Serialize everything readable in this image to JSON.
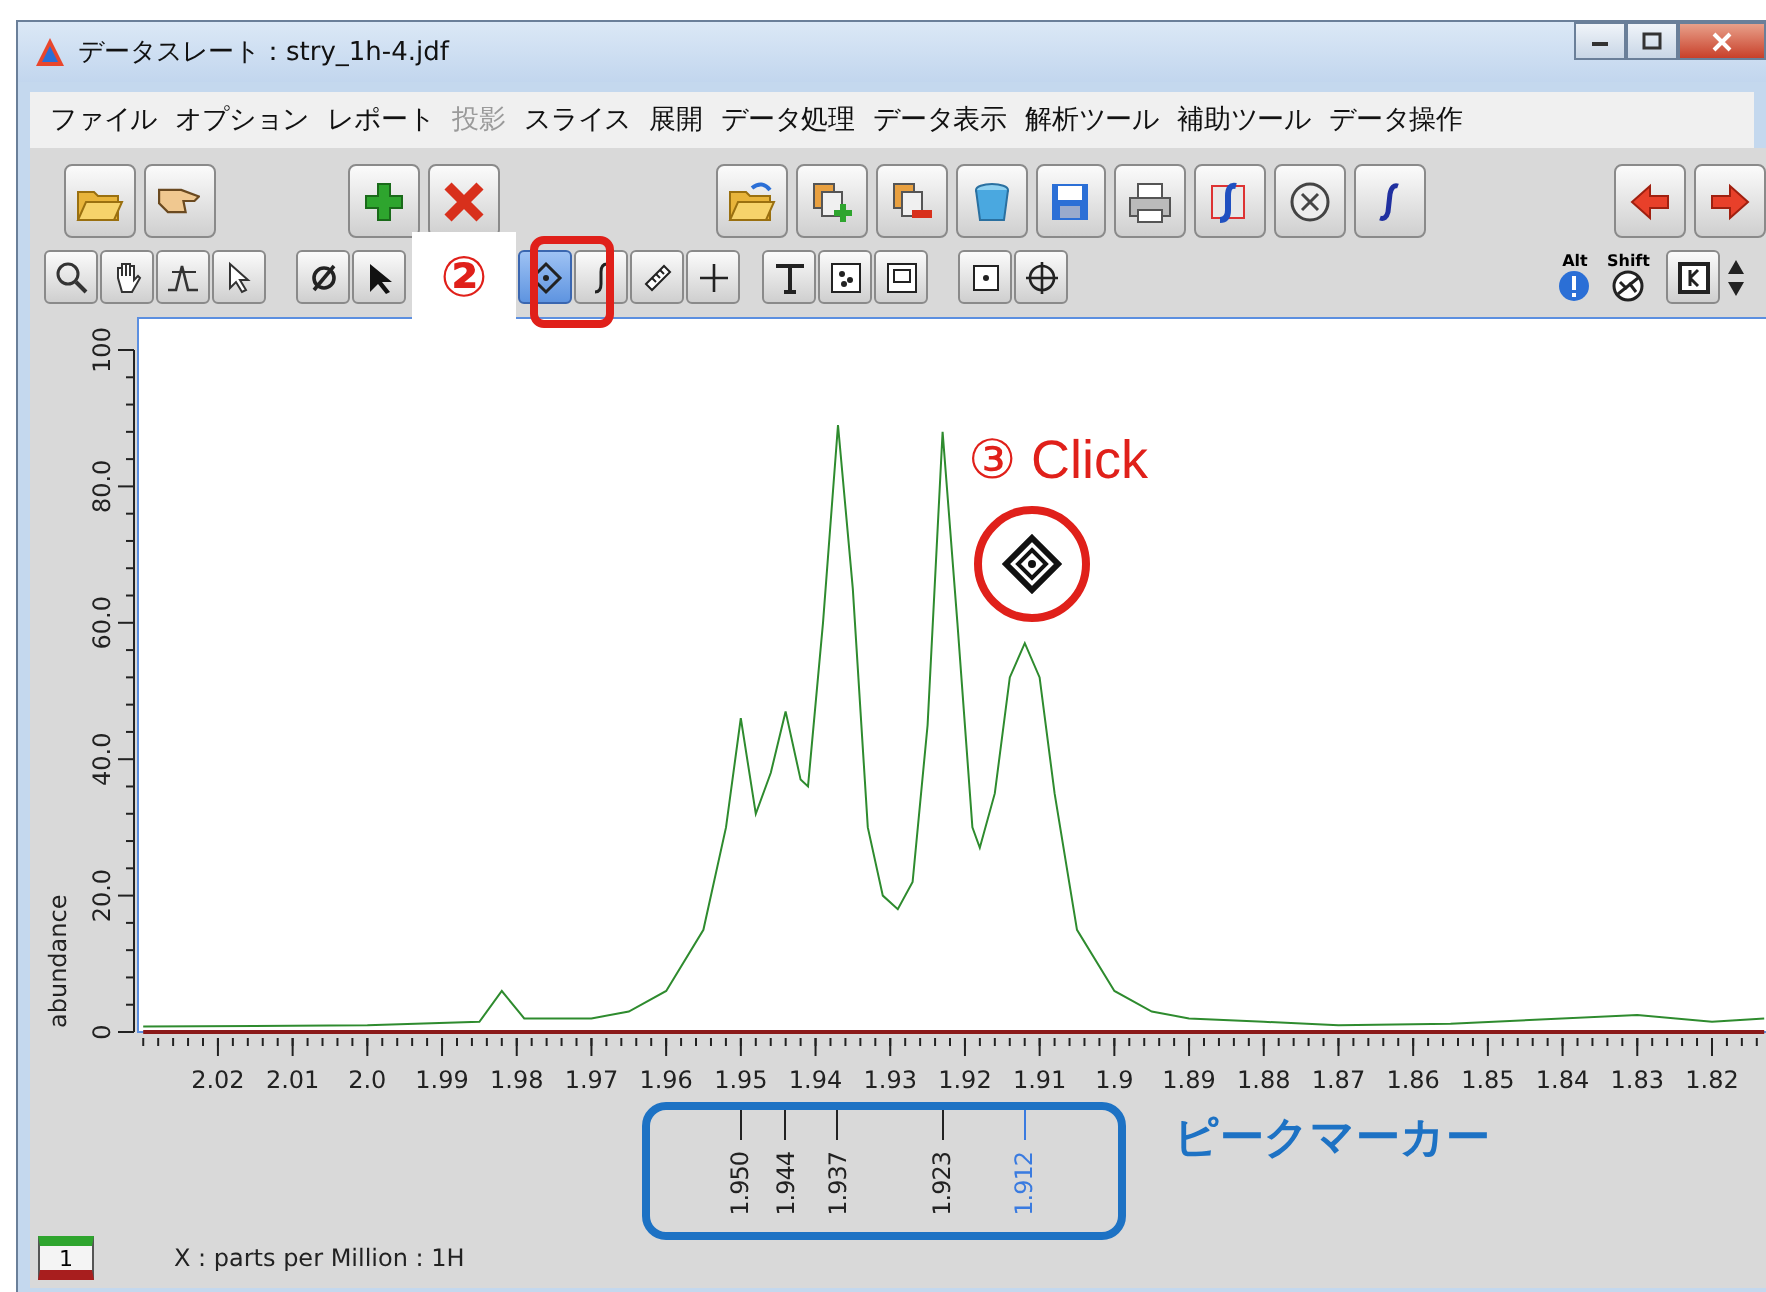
{
  "window": {
    "title": "データスレート：stry_1h-4.jdf"
  },
  "menu": [
    {
      "label": "ファイル",
      "disabled": false
    },
    {
      "label": "オプション",
      "disabled": false
    },
    {
      "label": "レポート",
      "disabled": false
    },
    {
      "label": "投影",
      "disabled": true
    },
    {
      "label": "スライス",
      "disabled": false
    },
    {
      "label": "展開",
      "disabled": false
    },
    {
      "label": "データ処理",
      "disabled": false
    },
    {
      "label": "データ表示",
      "disabled": false
    },
    {
      "label": "解析ツール",
      "disabled": false
    },
    {
      "label": "補助ツール",
      "disabled": false
    },
    {
      "label": "データ操作",
      "disabled": false
    }
  ],
  "toolbar2": [
    {
      "selected": false
    },
    {
      "selected": false
    },
    {
      "selected": false
    },
    {
      "selected": false
    },
    {
      "selected": false
    },
    {
      "selected": false
    },
    {
      "selected": true
    },
    {
      "selected": false
    },
    {
      "selected": false
    },
    {
      "selected": false
    },
    {
      "selected": false
    },
    {
      "selected": false
    },
    {
      "selected": false
    },
    {
      "selected": false
    },
    {
      "selected": false
    }
  ],
  "modifiers": [
    "Alt",
    "Shift"
  ],
  "plot": {
    "chart_data": {
      "type": "line",
      "ylabel": "abundance",
      "xlim": [
        2.0307,
        1.8125
      ],
      "ylim": [
        0,
        100
      ],
      "xticks": [
        {
          "value": 2.02,
          "label": "2.02"
        },
        {
          "value": 2.01,
          "label": "2.01"
        },
        {
          "value": 2.0,
          "label": "2.0"
        },
        {
          "value": 1.99,
          "label": "1.99"
        },
        {
          "value": 1.98,
          "label": "1.98"
        },
        {
          "value": 1.97,
          "label": "1.97"
        },
        {
          "value": 1.96,
          "label": "1.96"
        },
        {
          "value": 1.95,
          "label": "1.95"
        },
        {
          "value": 1.94,
          "label": "1.94"
        },
        {
          "value": 1.93,
          "label": "1.93"
        },
        {
          "value": 1.92,
          "label": "1.92"
        },
        {
          "value": 1.91,
          "label": "1.91"
        },
        {
          "value": 1.9,
          "label": "1.9"
        },
        {
          "value": 1.89,
          "label": "1.89"
        },
        {
          "value": 1.88,
          "label": "1.88"
        },
        {
          "value": 1.87,
          "label": "1.87"
        },
        {
          "value": 1.86,
          "label": "1.86"
        },
        {
          "value": 1.85,
          "label": "1.85"
        },
        {
          "value": 1.84,
          "label": "1.84"
        },
        {
          "value": 1.83,
          "label": "1.83"
        },
        {
          "value": 1.82,
          "label": "1.82"
        }
      ],
      "yticks": [
        {
          "value": 0,
          "label": "0"
        },
        {
          "value": 20,
          "label": "20.0"
        },
        {
          "value": 40,
          "label": "40.0"
        },
        {
          "value": 60,
          "label": "60.0"
        },
        {
          "value": 80,
          "label": "80.0"
        },
        {
          "value": 100,
          "label": "100"
        }
      ],
      "x": [
        2.03,
        2.0,
        1.985,
        1.982,
        1.979,
        1.97,
        1.965,
        1.96,
        1.955,
        1.952,
        1.95,
        1.948,
        1.946,
        1.944,
        1.942,
        1.941,
        1.939,
        1.937,
        1.935,
        1.933,
        1.931,
        1.929,
        1.927,
        1.925,
        1.923,
        1.921,
        1.919,
        1.918,
        1.916,
        1.914,
        1.912,
        1.91,
        1.908,
        1.905,
        1.9,
        1.895,
        1.89,
        1.88,
        1.87,
        1.855,
        1.83,
        1.82,
        1.813
      ],
      "series": [
        {
          "color": "#2e8b2e",
          "values": [
            0.8,
            1,
            1.5,
            6,
            2,
            2,
            3,
            6,
            15,
            30,
            46,
            32,
            38,
            47,
            37,
            36,
            60,
            89,
            65,
            30,
            20,
            18,
            22,
            45,
            88,
            60,
            30,
            27,
            35,
            52,
            57,
            52,
            35,
            15,
            6,
            3,
            2,
            1.5,
            1,
            1.2,
            2.5,
            1.5,
            2
          ]
        },
        {
          "color": "#8b1a1a",
          "values": [
            0,
            0,
            0,
            0,
            0,
            0,
            0,
            0,
            0,
            0,
            0,
            0,
            0,
            0,
            0,
            0,
            0,
            0,
            0,
            0,
            0,
            0,
            0,
            0,
            0,
            0,
            0,
            0,
            0,
            0,
            0,
            0,
            0,
            0,
            0,
            0,
            0,
            0,
            0,
            0,
            0,
            0,
            0
          ]
        }
      ]
    }
  },
  "peak_markers": [
    {
      "label": "1.950",
      "selected": false
    },
    {
      "label": "1.944",
      "selected": false
    },
    {
      "label": "1.937",
      "selected": false
    },
    {
      "label": "1.923",
      "selected": false
    },
    {
      "label": "1.912",
      "selected": true
    }
  ],
  "status_bar": {
    "page": "1",
    "axis": "X : parts per Million : 1H"
  },
  "annotations": [
    {
      "kind": "step",
      "text": "②"
    },
    {
      "kind": "click",
      "text": "③ Click"
    },
    {
      "kind": "region",
      "text": "ピークマーカー"
    }
  ]
}
